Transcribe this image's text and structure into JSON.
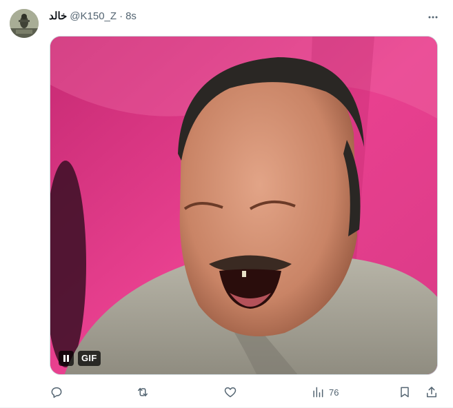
{
  "tweet": {
    "display_name": "خالد",
    "handle": "@K150_Z",
    "separator": "·",
    "time": "8s"
  },
  "media": {
    "type": "gif",
    "badge": "GIF",
    "playing": true
  },
  "actions": {
    "views_count": "76"
  },
  "icons": {
    "more": "more-horizontal-icon",
    "pause": "pause-icon",
    "reply": "reply-icon",
    "repost": "repost-icon",
    "like": "heart-icon",
    "views": "analytics-icon",
    "bookmark": "bookmark-icon",
    "share": "share-icon"
  },
  "colors": {
    "text_primary": "#0f1419",
    "text_secondary": "#536471",
    "border": "#cfd9de"
  }
}
